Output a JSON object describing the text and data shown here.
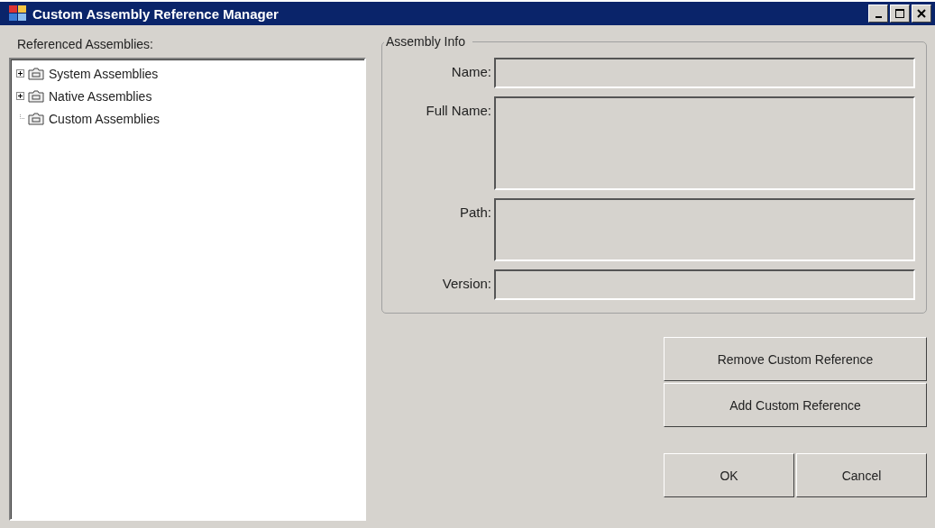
{
  "window": {
    "title": "Custom Assembly Reference Manager"
  },
  "tree": {
    "label": "Referenced Assemblies:",
    "items": [
      {
        "label": "System Assemblies",
        "has_children": true
      },
      {
        "label": "Native Assemblies",
        "has_children": true
      },
      {
        "label": "Custom Assemblies",
        "has_children": false
      }
    ]
  },
  "assembly_info": {
    "title": "Assembly Info",
    "fields": [
      {
        "label": "Name:",
        "kind": "single"
      },
      {
        "label": "Full Name:",
        "kind": "large"
      },
      {
        "label": "Path:",
        "kind": "medium"
      },
      {
        "label": "Version:",
        "kind": "single"
      }
    ]
  },
  "buttons": [
    "Remove Custom Reference",
    "Add Custom Reference"
  ],
  "dialog_buttons": [
    "OK",
    "Cancel"
  ]
}
